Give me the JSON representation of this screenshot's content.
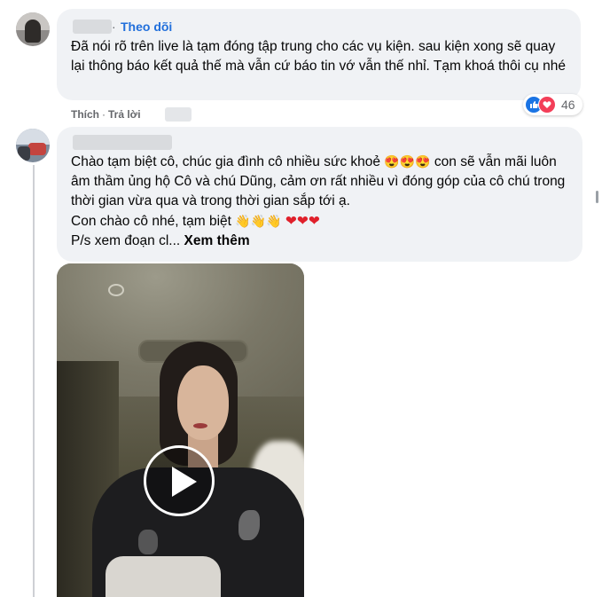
{
  "comments": [
    {
      "follow_label": "Theo dõi",
      "separator": "·",
      "text": "Đã nói rõ trên live là tạm đóng tập trung cho các vụ kiện. sau kiện xong sẽ quay lại thông báo kết quả thế mà vẫn cứ báo tin vớ vẫn thế nhỉ. Tạm khoá thôi cụ nhé",
      "actions": {
        "like_label": "Thích",
        "dot": "·",
        "reply_label": "Trả lời"
      },
      "reactions": {
        "count": "46",
        "icons": [
          "like-icon",
          "love-icon"
        ]
      }
    },
    {
      "text_lines": [
        {
          "before": "Chào tạm biệt cô, chúc gia đình cô nhiều sức khoẻ ",
          "emoji": "😍😍😍",
          "after": " con sẽ vẫn mãi luôn âm thầm ủng hộ Cô và chú Dũng, cảm ơn rất nhiều vì đóng góp của cô chú trong thời gian vừa qua và trong thời gian sắp tới ạ."
        },
        {
          "before": "Con chào cô nhé, tạm biệt ",
          "waves": "👋👋👋",
          "hearts": "❤❤❤"
        }
      ],
      "truncated_text": "P/s xem đoạn cl...",
      "see_more_label": "Xem thêm",
      "video": {
        "icon": "play-icon"
      }
    }
  ],
  "colors": {
    "bubble": "#f0f2f5",
    "link": "#216fdb",
    "meta": "#65676b",
    "like": "#1b74e4",
    "love": "#f33e58"
  }
}
